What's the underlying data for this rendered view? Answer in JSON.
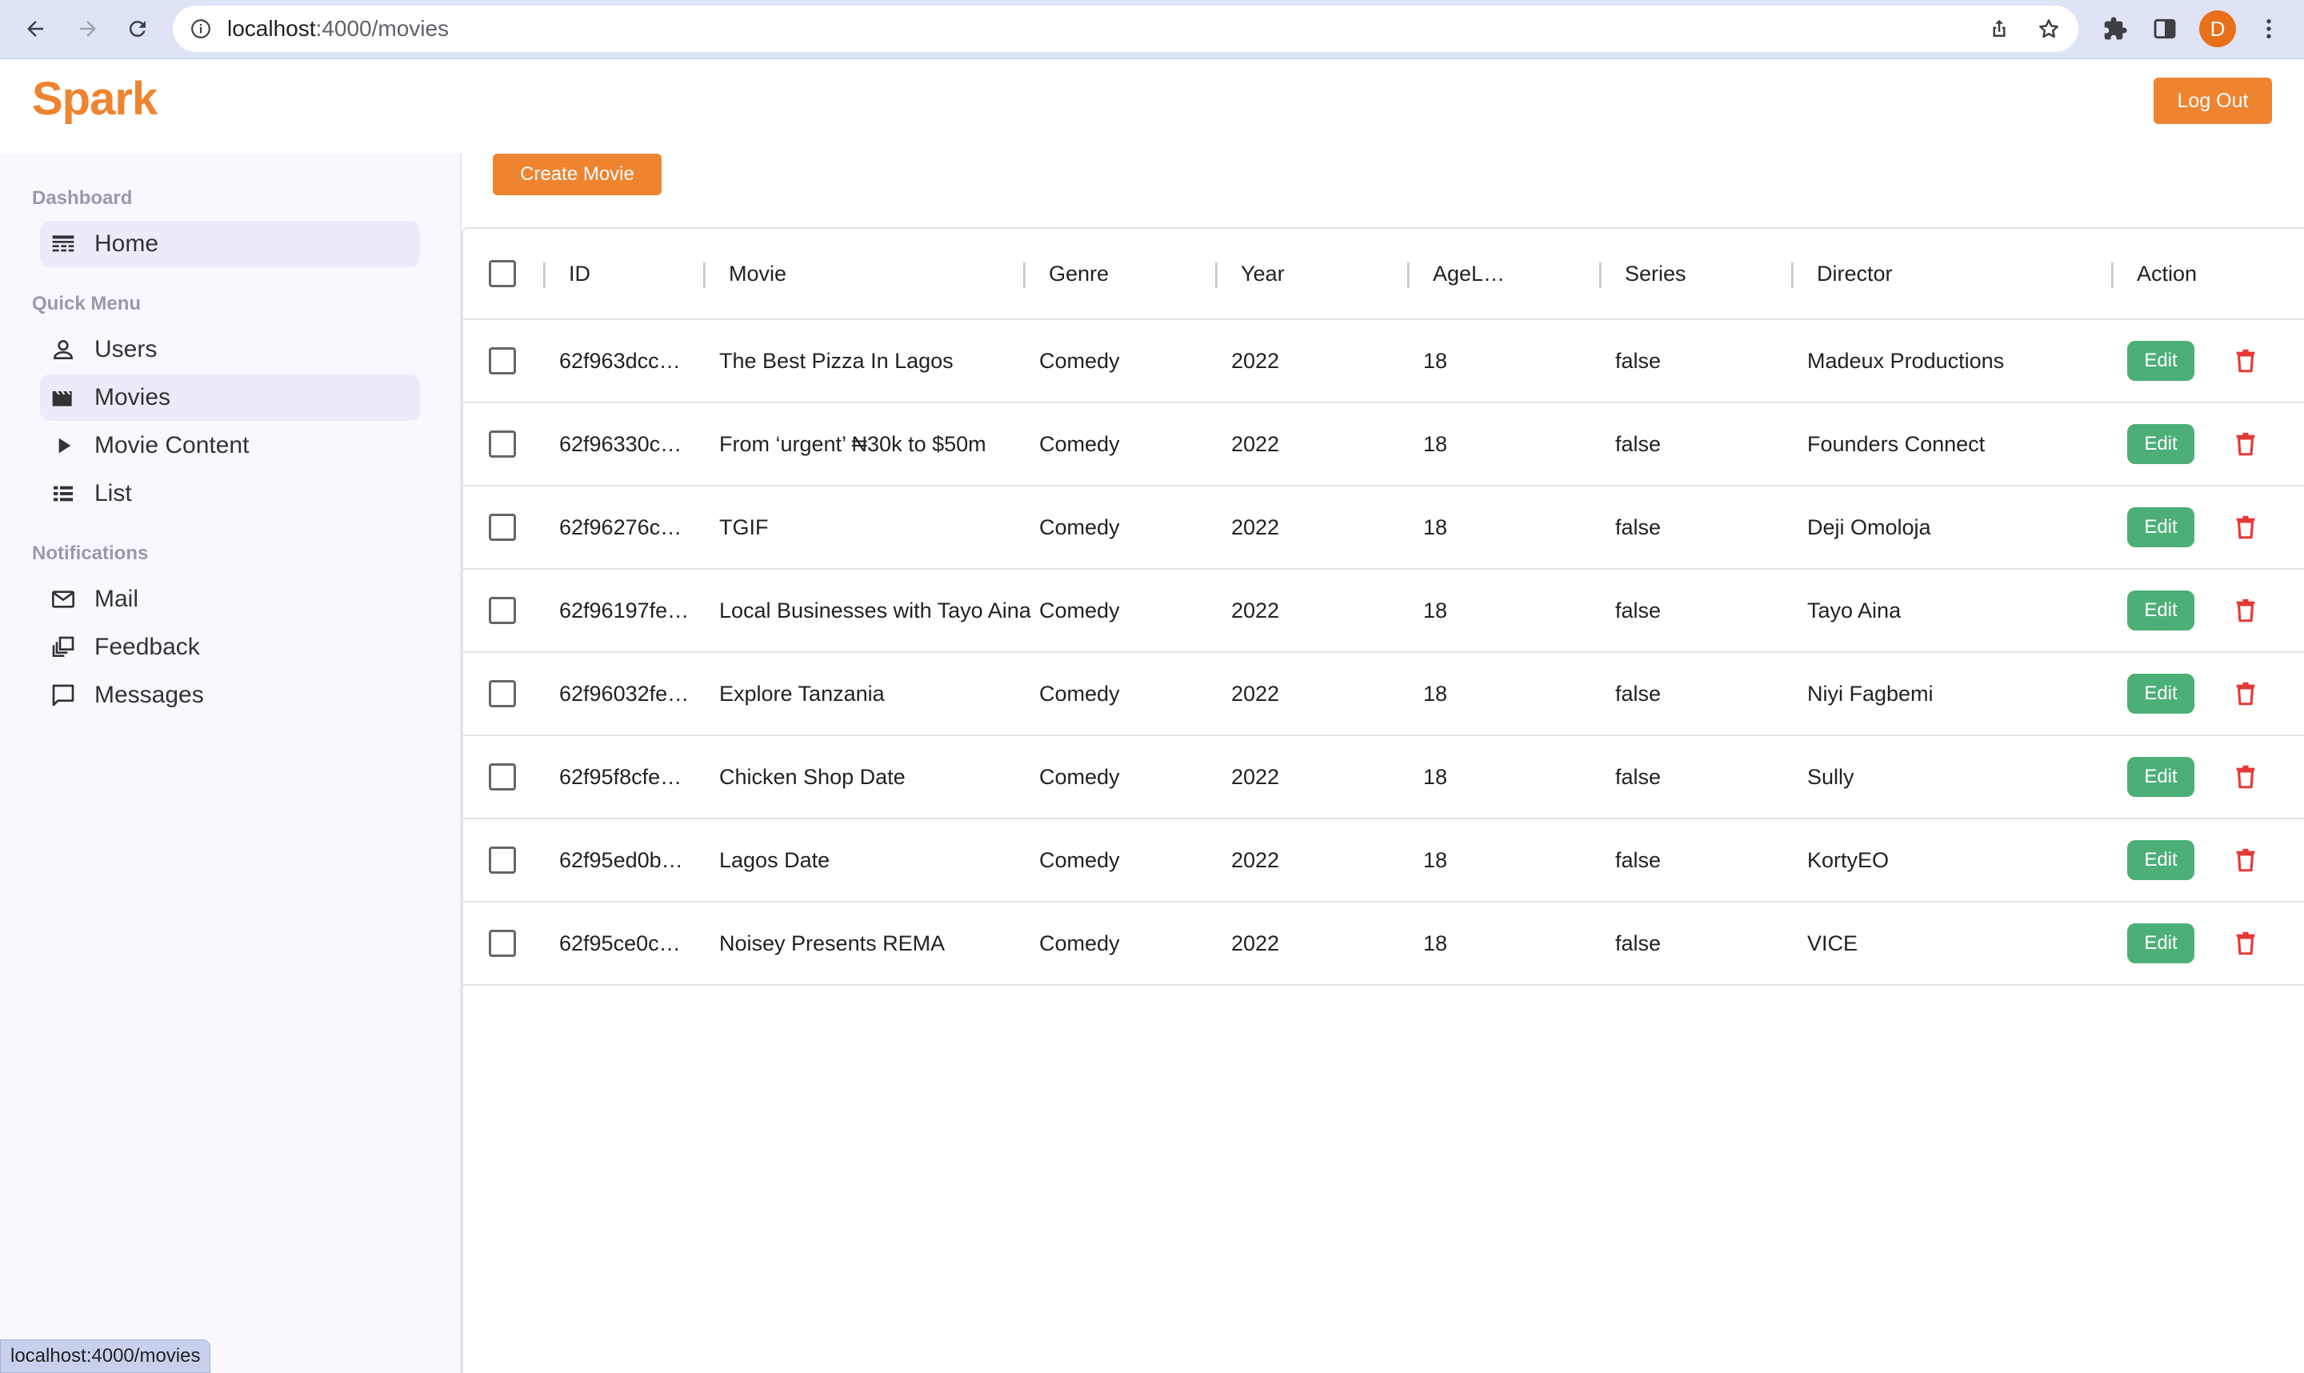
{
  "browser": {
    "url_host": "localhost",
    "url_rest": ":4000/movies",
    "avatar_letter": "D",
    "status_url": "localhost:4000/movies"
  },
  "header": {
    "logo": "Spark",
    "logout_label": "Log Out"
  },
  "sidebar": {
    "sections": [
      {
        "title": "Dashboard",
        "items": [
          {
            "label": "Home",
            "icon": "dashboard-icon",
            "active": true
          }
        ]
      },
      {
        "title": "Quick Menu",
        "items": [
          {
            "label": "Users",
            "icon": "user-icon"
          },
          {
            "label": "Movies",
            "icon": "movie-clapper-icon",
            "active": true
          },
          {
            "label": "Movie Content",
            "icon": "play-icon"
          },
          {
            "label": "List",
            "icon": "list-icon"
          }
        ]
      },
      {
        "title": "Notifications",
        "items": [
          {
            "label": "Mail",
            "icon": "mail-icon"
          },
          {
            "label": "Feedback",
            "icon": "feedback-icon"
          },
          {
            "label": "Messages",
            "icon": "message-icon"
          }
        ]
      }
    ]
  },
  "main": {
    "create_label": "Create Movie",
    "columns": [
      "ID",
      "Movie",
      "Genre",
      "Year",
      "AgeL…",
      "Series",
      "Director",
      "Action"
    ],
    "edit_label": "Edit",
    "rows": [
      {
        "id": "62f963dcc…",
        "movie": "The Best Pizza In Lagos",
        "genre": "Comedy",
        "year": "2022",
        "age": "18",
        "series": "false",
        "director": "Madeux Productions"
      },
      {
        "id": "62f96330c…",
        "movie": "From ‘urgent’ ₦30k to $50m",
        "genre": "Comedy",
        "year": "2022",
        "age": "18",
        "series": "false",
        "director": "Founders Connect"
      },
      {
        "id": "62f96276c…",
        "movie": "TGIF",
        "genre": "Comedy",
        "year": "2022",
        "age": "18",
        "series": "false",
        "director": "Deji Omoloja"
      },
      {
        "id": "62f96197fe…",
        "movie": "Local Businesses with Tayo Aina",
        "genre": "Comedy",
        "year": "2022",
        "age": "18",
        "series": "false",
        "director": "Tayo Aina"
      },
      {
        "id": "62f96032fe…",
        "movie": "Explore Tanzania",
        "genre": "Comedy",
        "year": "2022",
        "age": "18",
        "series": "false",
        "director": "Niyi Fagbemi"
      },
      {
        "id": "62f95f8cfe…",
        "movie": "Chicken Shop Date",
        "genre": "Comedy",
        "year": "2022",
        "age": "18",
        "series": "false",
        "director": "Sully"
      },
      {
        "id": "62f95ed0b…",
        "movie": "Lagos Date",
        "genre": "Comedy",
        "year": "2022",
        "age": "18",
        "series": "false",
        "director": "KortyEO"
      },
      {
        "id": "62f95ce0c…",
        "movie": "Noisey Presents REMA",
        "genre": "Comedy",
        "year": "2022",
        "age": "18",
        "series": "false",
        "director": "VICE"
      }
    ]
  },
  "colors": {
    "brand": "#ee8430",
    "edit": "#4caf78",
    "delete": "#e53935"
  }
}
